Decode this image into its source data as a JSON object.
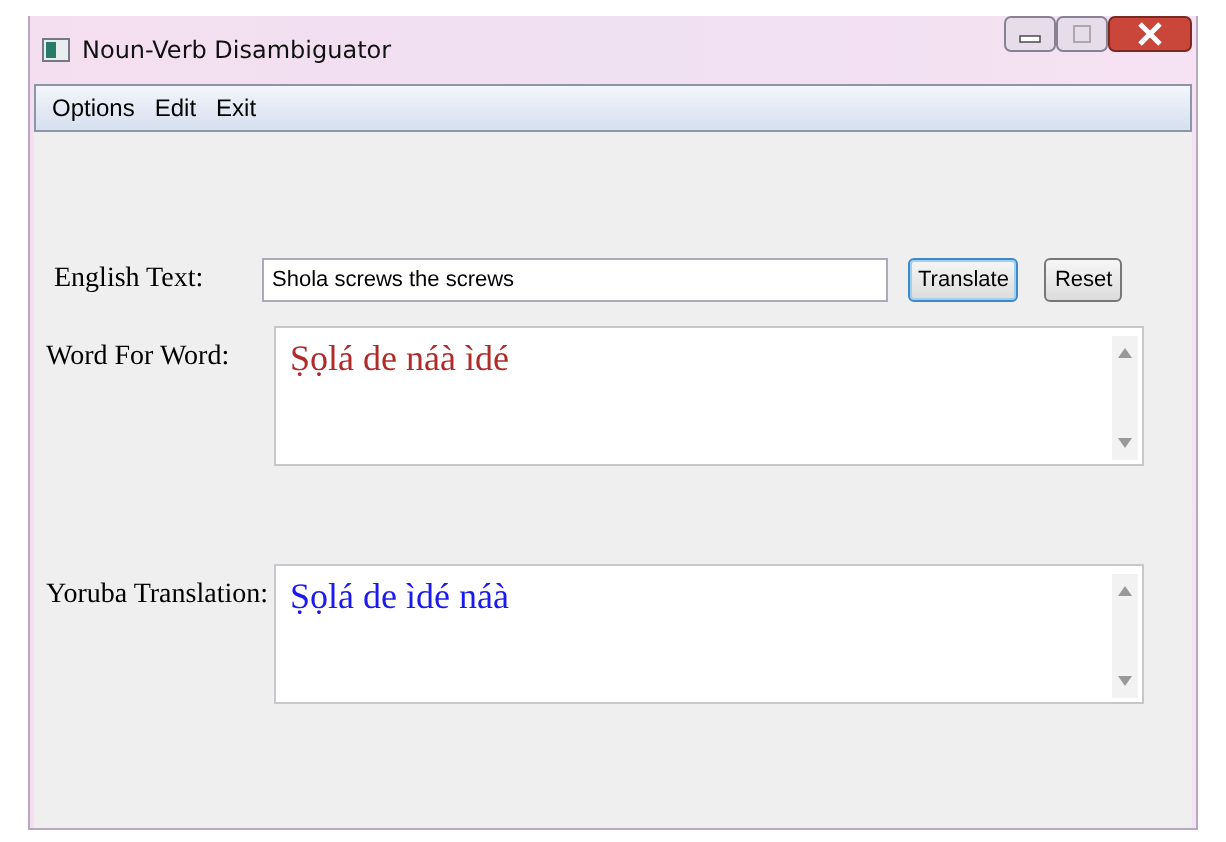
{
  "window": {
    "title": "Noun-Verb Disambiguator"
  },
  "menu": [
    "Options",
    "Edit",
    "Exit"
  ],
  "english_text": {
    "label": "English Text:",
    "value": "Shola screws the screws"
  },
  "buttons": [
    {
      "label": "Translate",
      "selected": true
    },
    {
      "label": "Reset",
      "selected": false
    }
  ],
  "outputs": [
    {
      "label": "Word For Word:",
      "value": "Ṣọlá de náà ìdé",
      "color": "#b02a2a"
    },
    {
      "label": "Yoruba Translation:",
      "value": "Ṣọlá de ìdé náà",
      "color": "#1a1aee"
    }
  ]
}
